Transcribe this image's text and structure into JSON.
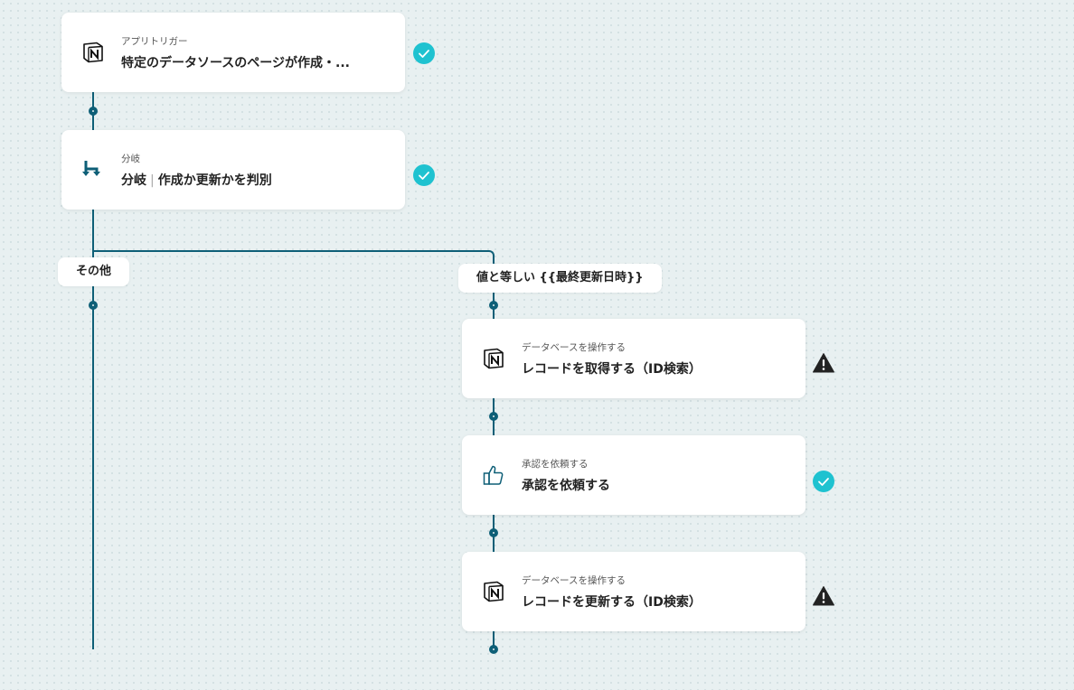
{
  "nodes": [
    {
      "type_label": "アプリトリガー",
      "title": "特定のデータソースのページが作成・..."
    },
    {
      "type_label": "分岐",
      "title_main": "分岐",
      "title_sep": "|",
      "title_sub": "作成か更新かを判別"
    },
    {
      "type_label": "データベースを操作する",
      "title": "レコードを取得する（ID検索）"
    },
    {
      "type_label": "承認を依頼する",
      "title": "承認を依頼する"
    },
    {
      "type_label": "データベースを操作する",
      "title": "レコードを更新する（ID検索）"
    }
  ],
  "branches": {
    "other": "その他",
    "equals": "値と等しい {{最終更新日時}}"
  },
  "icons": {
    "notion": "notion-logo-icon",
    "branch": "branch-icon",
    "approval": "thumbs-up-icon",
    "ok": "check-circle-icon",
    "warn": "warning-icon"
  },
  "colors": {
    "line": "#0e5f77",
    "ok": "#1fc2d0",
    "warn": "#222222"
  }
}
